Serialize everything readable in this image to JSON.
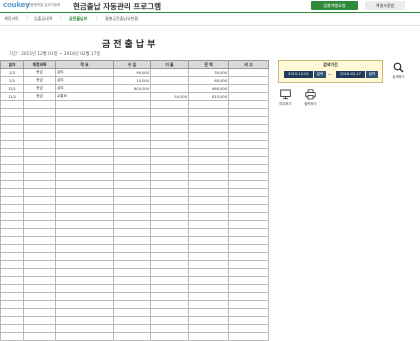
{
  "header": {
    "logo": "coukey",
    "logo_sub": "맞춤형엑셀 업무자동화",
    "title": "현금출납 자동관리 프로그램",
    "custom_btn": "맞춤엑셀요청",
    "manual_btn": "엑셀사용법"
  },
  "tabs": [
    {
      "label": "계정과목"
    },
    {
      "label": "입출금내역"
    },
    {
      "label": "금전출납부"
    },
    {
      "label": "월별금전출납부현황"
    }
  ],
  "page": {
    "heading": "금전출납부",
    "period_text": "기간 : 2015년 12월 01일 ~ 2016년 02월 17일"
  },
  "table": {
    "columns": [
      "일자",
      "계정과목",
      "적 요",
      "수 입",
      "지 출",
      "잔 액",
      "비 고"
    ],
    "rows": [
      [
        "2/3",
        "현금",
        "급여",
        "90,000",
        "",
        "30,000",
        ""
      ],
      [
        "2/5",
        "현금",
        "급여",
        "10,000",
        "",
        "60,000",
        ""
      ],
      [
        "12/1",
        "현금",
        "급여",
        "800,000",
        "",
        "860,000",
        ""
      ],
      [
        "12/2",
        "현금",
        "교통비",
        "",
        "50,000",
        "810,000",
        ""
      ]
    ]
  },
  "side": {
    "period_title": "검색기간",
    "start_date": "2015-12-01",
    "end_date": "2016-02-17",
    "cal_label": "달력",
    "search_label": "검색하기",
    "preview_label": "미리보기",
    "print_label": "출력하기"
  },
  "colors": {
    "brand_green": "#2e8b3a",
    "date_bg": "#1f3a5a",
    "period_box": "#fff9d6",
    "header_bg": "#d9d9d9"
  }
}
